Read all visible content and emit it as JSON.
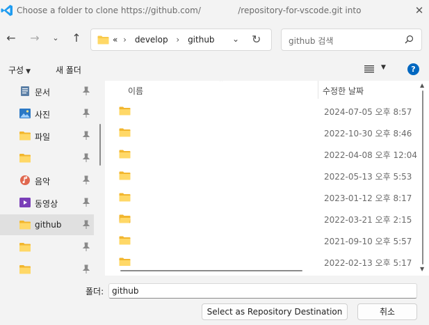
{
  "window": {
    "title": "Choose a folder to clone https://github.com/              /repository-for-vscode.git into"
  },
  "address": {
    "prefix": "«",
    "segments": [
      "develop",
      "github"
    ],
    "separator": "›"
  },
  "search": {
    "placeholder": "github 검색"
  },
  "command_bar": {
    "organize": "구성",
    "new_folder": "새 폴더",
    "help": "?"
  },
  "sidebar": {
    "items": [
      {
        "label": "문서",
        "icon": "documents-icon"
      },
      {
        "label": "사진",
        "icon": "pictures-icon"
      },
      {
        "label": "파일",
        "icon": "folder-icon"
      },
      {
        "label": "",
        "icon": "folder-icon"
      },
      {
        "label": "음악",
        "icon": "music-icon"
      },
      {
        "label": "동영상",
        "icon": "videos-icon"
      },
      {
        "label": "github",
        "icon": "folder-icon",
        "selected": true
      },
      {
        "label": "",
        "icon": "folder-icon"
      },
      {
        "label": "",
        "icon": "folder-icon"
      }
    ]
  },
  "file_list": {
    "columns": {
      "name": "이름",
      "modified": "수정한 날짜"
    },
    "rows": [
      {
        "name": "",
        "modified": "2024-07-05 오후 8:57"
      },
      {
        "name": "",
        "modified": "2022-10-30 오후 8:46"
      },
      {
        "name": "",
        "modified": "2022-04-08 오후 12:04"
      },
      {
        "name": "",
        "modified": "2022-05-13 오후 5:53"
      },
      {
        "name": "",
        "modified": "2023-01-12 오후 8:17"
      },
      {
        "name": "",
        "modified": "2022-03-21 오후 2:15"
      },
      {
        "name": "",
        "modified": "2021-09-10 오후 5:57"
      },
      {
        "name": "",
        "modified": "2022-02-13 오후 5:17"
      }
    ]
  },
  "footer": {
    "folder_label": "폴더:",
    "folder_value": "github",
    "select_button": "Select as Repository Destination",
    "cancel_button": "취소"
  },
  "colors": {
    "accent": "#0067c0",
    "folder": "#f8c94a",
    "vscode": "#1f9cf0"
  }
}
